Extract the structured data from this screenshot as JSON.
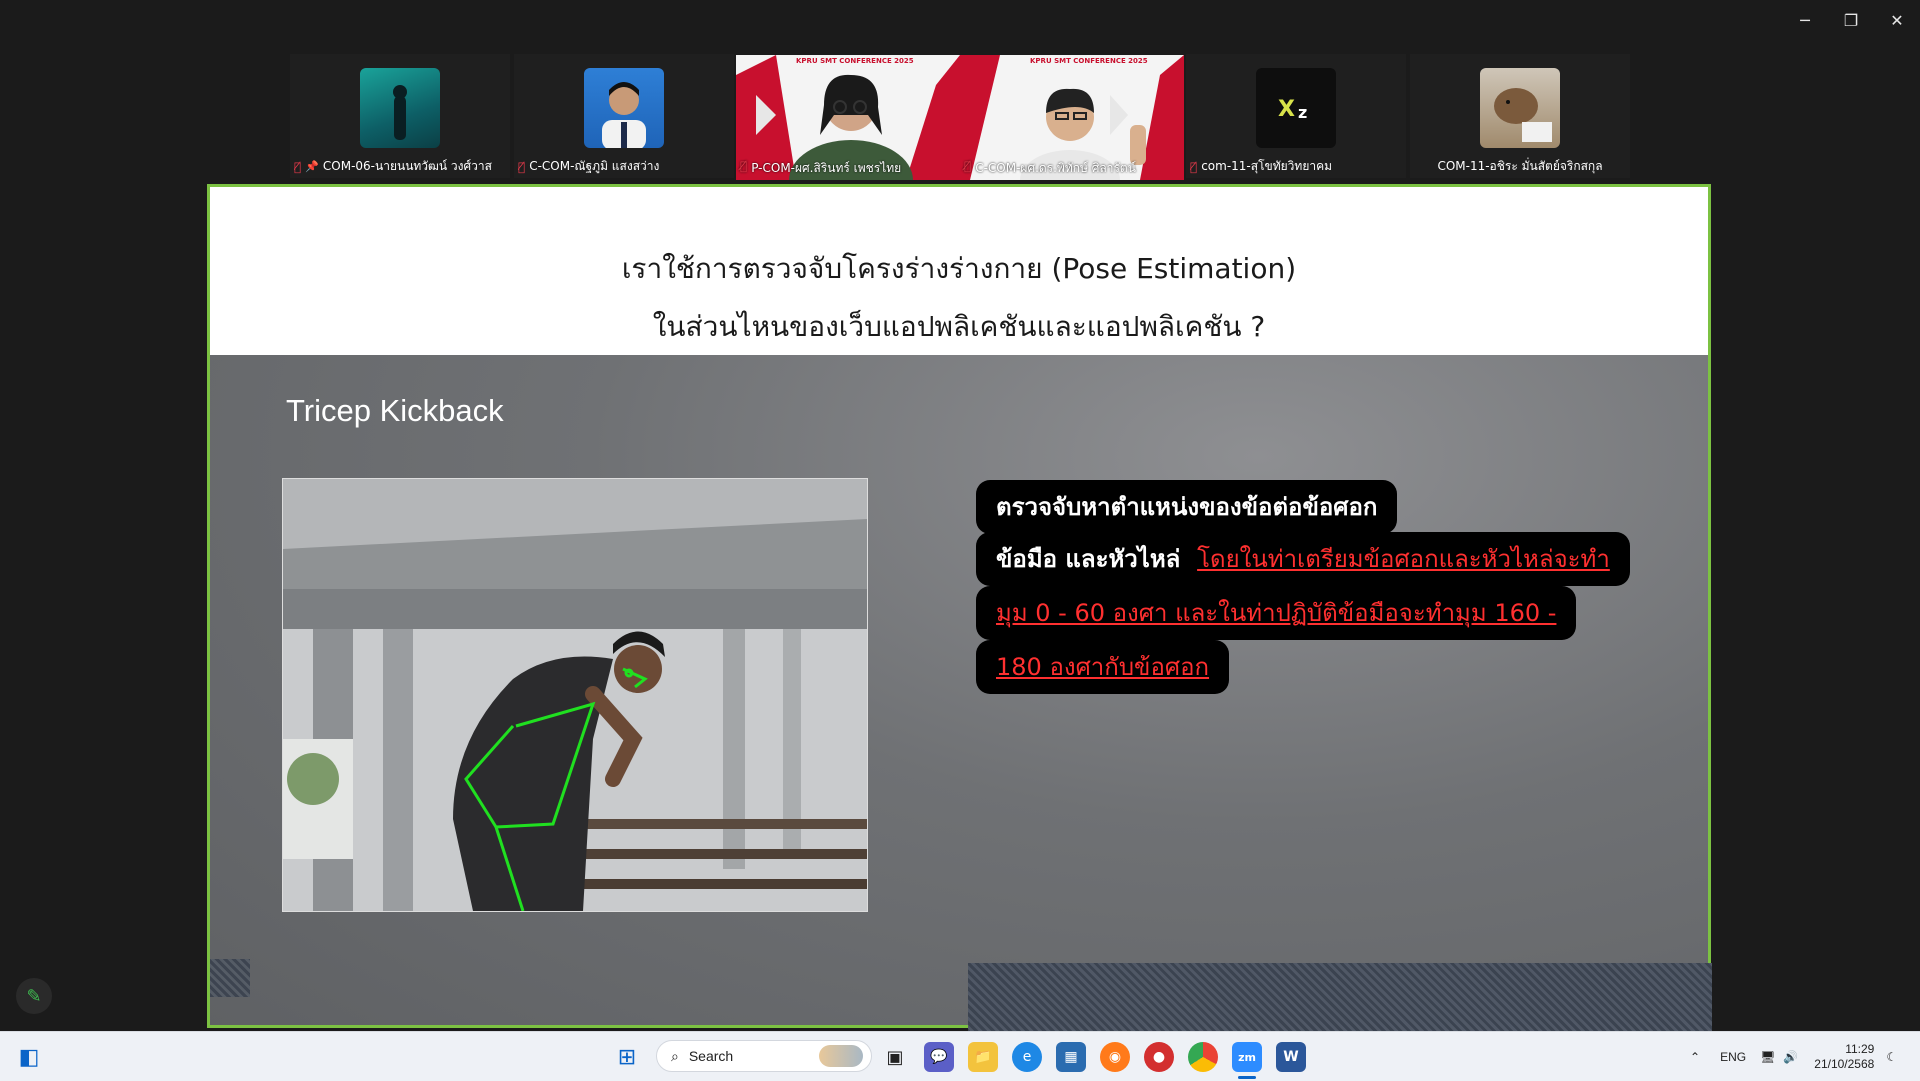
{
  "window": {
    "minimize": "─",
    "maximize": "❐",
    "close": "✕"
  },
  "participants": [
    {
      "name": "COM-06-นายนนทวัฒน์ วงศ์วาส",
      "muted": true,
      "pinned": true
    },
    {
      "name": "C-COM-ณัฐภูมิ แสงสว่าง",
      "muted": true,
      "pinned": false
    },
    {
      "name": "P-COM-ผศ.สิรินทร์ เพชรไทย",
      "muted": true,
      "pinned": false,
      "video_banner": "KPRU SMT CONFERENCE 2025"
    },
    {
      "name": "C-COM-ผศ.ดร.พิทักษ์ ศิลารัตน์",
      "muted": true,
      "pinned": false,
      "video_banner": "KPRU SMT CONFERENCE 2025"
    },
    {
      "name": "com-11-สุโขทัยวิทยาคม",
      "muted": true,
      "pinned": false
    },
    {
      "name": "COM-11-อชิระ มั่นสัตย์จริกสกุล",
      "muted": false,
      "pinned": false
    }
  ],
  "slide": {
    "title_line1": "เราใช้การตรวจจับโครงร่างร่างกาย (Pose Estimation)",
    "title_line2": "ในส่วนไหนของเว็บแอปพลิเคชันและแอปพลิเคชัน ?",
    "subtitle": "Tricep Kickback",
    "callout": {
      "line1": "ตรวจจับหาตำแหน่งของข้อต่อข้อศอก",
      "line2_white": "ข้อมือ และหัวไหล่",
      "line2_red": "โดยในท่าเตรียมข้อศอกและหัวไหล่จะทำ",
      "line3_red": "มุม 0 - 60 องศา และในท่าปฏิบัติข้อมือจะทำมุม 160 -",
      "line4_red": "180 องศากับข้อศอก"
    }
  },
  "taskbar": {
    "search_placeholder": "Search",
    "language": "ENG",
    "time": "11:29",
    "date": "21/10/2568"
  },
  "colors": {
    "share_border": "#7cc242",
    "callout_red": "#ff3030",
    "mute_red": "#e5394a"
  }
}
